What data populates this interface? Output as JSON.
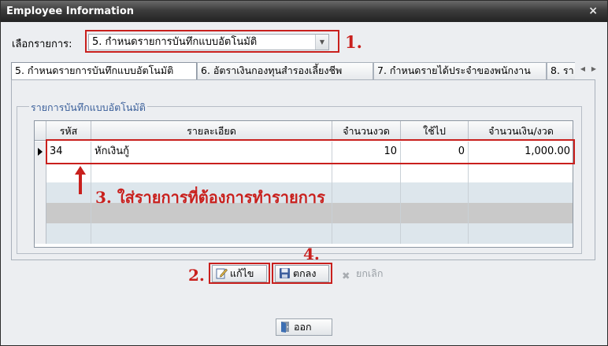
{
  "window": {
    "title": "Employee Information",
    "close_label": "×"
  },
  "selector": {
    "label": "เลือกรายการ:",
    "value": "5. กำหนดรายการบันทึกแบบอัตโนมัติ"
  },
  "tabs": [
    {
      "label": "5. กำหนดรายการบันทึกแบบอัตโนมัติ",
      "active": true
    },
    {
      "label": "6. อัตราเงินกองทุนสำรองเลี้ยงชีพ",
      "active": false
    },
    {
      "label": "7. กำหนดรายได้ประจำของพนักงาน",
      "active": false
    },
    {
      "label": "8. รา",
      "active": false
    }
  ],
  "group": {
    "title": "รายการบันทึกแบบอัตโนมัติ"
  },
  "grid": {
    "columns": [
      "รหัส",
      "รายละเอียด",
      "จำนวนงวด",
      "ใช้ไป",
      "จำนวนเงิน/งวด"
    ],
    "rows": [
      {
        "code": "34",
        "detail": "หักเงินกู้",
        "installments": "10",
        "used": "0",
        "amount": "1,000.00"
      }
    ]
  },
  "buttons": {
    "edit": "แก้ไข",
    "ok": "ตกลง",
    "cancel": "ยกเลิก",
    "exit": "ออก"
  },
  "annotations": {
    "step1": "1.",
    "step2": "2.",
    "step3": "3. ใส่รายการที่ต้องการทำรายการ",
    "step4": "4."
  },
  "colors": {
    "annotation": "#c9201d",
    "titlebar": "#3c3c3c",
    "group_title": "#3a5f9a"
  }
}
